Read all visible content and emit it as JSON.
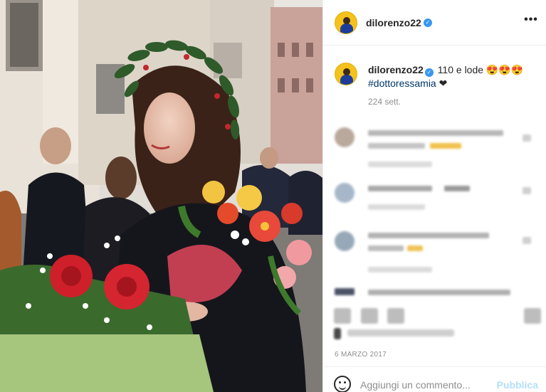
{
  "colors": {
    "verified_blue": "#3897f0",
    "hashtag_blue": "#003569",
    "muted_gray": "#8e8e8e",
    "post_button_disabled": "#b2dffc",
    "divider": "#efefef"
  },
  "photo": {
    "subject": "graduate wearing a laurel wreath holding flower bouquets",
    "icon": "photo-image"
  },
  "header": {
    "username": "dilorenzo22",
    "verified_icon": "check-badge-icon",
    "more_icon": "•••"
  },
  "caption": {
    "username": "dilorenzo22",
    "text": "110 e lode 😍😍😍",
    "hashtag": "#dottoressamia",
    "heart": "❤",
    "time": "224 sett."
  },
  "comments_note": "blurred",
  "date": "6 MARZO 2017",
  "add_comment": {
    "placeholder": "Aggiungi un commento...",
    "post_label": "Pubblica",
    "emoji_icon": "smiley-icon"
  }
}
